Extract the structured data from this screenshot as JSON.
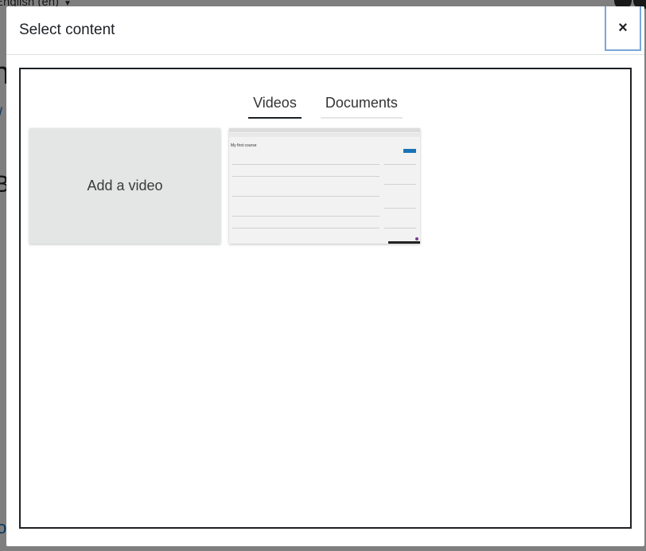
{
  "background": {
    "language_menu": "English (en)",
    "big_letter": "n",
    "slash": "/",
    "letter_b": "B",
    "letter_o": "o"
  },
  "modal": {
    "title": "Select content",
    "close_label": "×"
  },
  "tabs": [
    {
      "label": "Videos",
      "active": true
    },
    {
      "label": "Documents",
      "active": false
    }
  ],
  "tiles": {
    "add_video_label": "Add a video",
    "thumbnail_title": "My first course"
  }
}
